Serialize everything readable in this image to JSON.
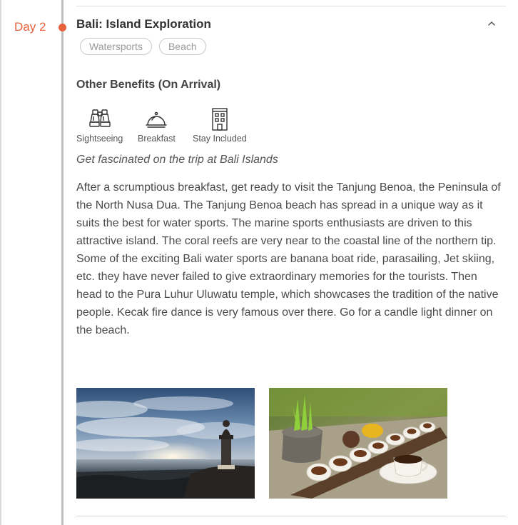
{
  "itinerary": {
    "day_label": "Day 2",
    "day_title": "Bali: Island Exploration",
    "tags": [
      "Watersports",
      "Beach"
    ],
    "collapse_icon": "chevron-up-icon",
    "benefits_heading": "Other Benefits (On Arrival)",
    "benefits": [
      {
        "label": "Sightseeing",
        "icon": "binoculars-icon"
      },
      {
        "label": "Breakfast",
        "icon": "cloche-icon"
      },
      {
        "label": "Stay Included",
        "icon": "hotel-building-icon"
      }
    ],
    "subtitle": "Get fascinated on the trip at Bali Islands",
    "description": "After a scrumptious breakfast, get ready to visit the Tanjung Benoa, the Peninsula of the North Nusa Dua. The Tanjung Benoa beach has spread in a unique way as it suits the best for water sports. The marine sports enthusiasts are driven to this attractive island. The coral reefs are very near to the coastal line of the northern tip. Some of the exciting Bali water sports are banana boat ride, parasailing, Jet skiing, etc. they have never failed to give extraordinary memories for the tourists. Then head to the Pura Luhur Uluwatu temple, which showcases the tradition of the native people. Kecak fire dance is very famous over there. Go for a candle light dinner on the beach."
  },
  "colors": {
    "accent": "#e8603c",
    "timeline": "#bdbdbd",
    "tag_border": "#c7c7c7",
    "tag_text": "#9a9a9a",
    "heading_text": "#333333",
    "body_text": "#4a4a4a"
  }
}
